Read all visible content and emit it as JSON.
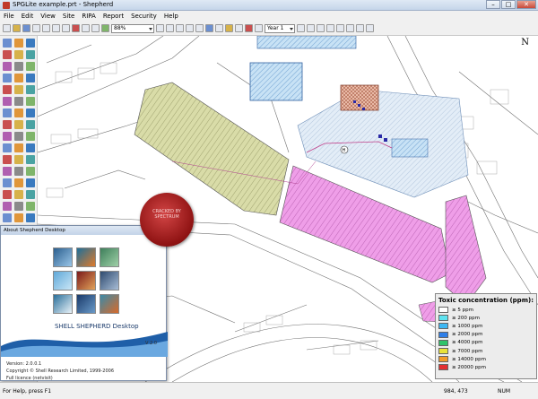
{
  "window": {
    "title": "SPGLite example.prt - Shepherd"
  },
  "menu": [
    "File",
    "Edit",
    "View",
    "Site",
    "RIPA",
    "Report",
    "Security",
    "Help"
  ],
  "toolbar": {
    "zoom_value": "88%",
    "year_value": "Year 1"
  },
  "map": {
    "north_label": "N"
  },
  "legend": {
    "title": "Toxic concentration (ppm):",
    "items": [
      {
        "label": "≥ 5 ppm",
        "color": "#ffffff"
      },
      {
        "label": "≥ 200 ppm",
        "color": "#5fe3f0"
      },
      {
        "label": "≥ 1000 ppm",
        "color": "#3db7f3"
      },
      {
        "label": "≥ 2000 ppm",
        "color": "#2f7fe8"
      },
      {
        "label": "≥ 4000 ppm",
        "color": "#30c36a"
      },
      {
        "label": "≥ 7000 ppm",
        "color": "#e8e23a"
      },
      {
        "label": "≥ 14000 ppm",
        "color": "#f29b2a"
      },
      {
        "label": "≥ 20000 ppm",
        "color": "#e23030"
      }
    ]
  },
  "splash": {
    "title": "About Shepherd Desktop",
    "product_name": "SHELL SHEPHERD Desktop",
    "version_short": "V 2.0",
    "version_line": "Version: 2.0.0.1",
    "copyright": "Copyright © Shell Research Limited, 1999-2006",
    "licence": "Full licence (netvisit)",
    "seal_text": "CRACKED BY SPECTRUM"
  },
  "status": {
    "help": "For Help, press F1",
    "coords": "984, 473",
    "num": "NUM"
  }
}
